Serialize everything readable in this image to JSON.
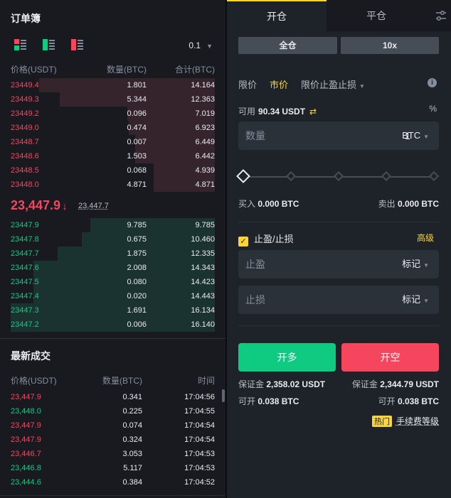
{
  "orderbook": {
    "title": "订单簿",
    "precision": "0.1",
    "headers": {
      "price": "价格(USDT)",
      "qty": "数量(BTC)",
      "total": "合计(BTC)"
    },
    "asks": [
      {
        "price": "23449.4",
        "qty": "1.801",
        "total": "14.164",
        "depth": 0.86
      },
      {
        "price": "23449.3",
        "qty": "5.344",
        "total": "12.363",
        "depth": 0.76
      },
      {
        "price": "23449.2",
        "qty": "0.096",
        "total": "7.019",
        "depth": 0.43
      },
      {
        "price": "23449.0",
        "qty": "0.474",
        "total": "6.923",
        "depth": 0.42
      },
      {
        "price": "23448.7",
        "qty": "0.007",
        "total": "6.449",
        "depth": 0.39
      },
      {
        "price": "23448.6",
        "qty": "1.503",
        "total": "6.442",
        "depth": 0.39
      },
      {
        "price": "23448.5",
        "qty": "0.068",
        "total": "4.939",
        "depth": 0.3
      },
      {
        "price": "23448.0",
        "qty": "4.871",
        "total": "4.871",
        "depth": 0.3
      }
    ],
    "last_price": "23,447.9",
    "mark_price": "23,447.7",
    "bids": [
      {
        "price": "23447.9",
        "qty": "9.785",
        "total": "9.785",
        "depth": 0.61
      },
      {
        "price": "23447.8",
        "qty": "0.675",
        "total": "10.460",
        "depth": 0.65
      },
      {
        "price": "23447.7",
        "qty": "1.875",
        "total": "12.335",
        "depth": 0.77
      },
      {
        "price": "23447.6",
        "qty": "2.008",
        "total": "14.343",
        "depth": 0.89
      },
      {
        "price": "23447.5",
        "qty": "0.080",
        "total": "14.423",
        "depth": 0.89
      },
      {
        "price": "23447.4",
        "qty": "0.020",
        "total": "14.443",
        "depth": 0.89
      },
      {
        "price": "23447.3",
        "qty": "1.691",
        "total": "16.134",
        "depth": 1.0
      },
      {
        "price": "23447.2",
        "qty": "0.006",
        "total": "16.140",
        "depth": 1.0
      }
    ]
  },
  "trades": {
    "title": "最新成交",
    "headers": {
      "price": "价格(USDT)",
      "qty": "数量(BTC)",
      "time": "时间"
    },
    "rows": [
      {
        "price": "23,447.9",
        "qty": "0.341",
        "time": "17:04:56",
        "side": "sell"
      },
      {
        "price": "23,448.0",
        "qty": "0.225",
        "time": "17:04:55",
        "side": "buy"
      },
      {
        "price": "23,447.9",
        "qty": "0.074",
        "time": "17:04:54",
        "side": "sell"
      },
      {
        "price": "23,447.9",
        "qty": "0.324",
        "time": "17:04:54",
        "side": "sell"
      },
      {
        "price": "23,446.7",
        "qty": "3.053",
        "time": "17:04:53",
        "side": "sell"
      },
      {
        "price": "23,446.8",
        "qty": "5.117",
        "time": "17:04:53",
        "side": "buy"
      },
      {
        "price": "23,444.6",
        "qty": "0.384",
        "time": "17:04:52",
        "side": "buy"
      }
    ]
  },
  "trade_panel": {
    "tab_open": "开仓",
    "tab_close": "平仓",
    "margin_mode": "全仓",
    "leverage": "10x",
    "order_types": [
      "限价",
      "市价",
      "限价止盈止损"
    ],
    "active_order_type": 1,
    "available_label": "可用",
    "available_value": "90.34 USDT",
    "qty_label": "数量",
    "qty_value": "1",
    "qty_unit": "BTC",
    "slider_percent": 0,
    "buy_label": "买入",
    "buy_value": "0.000 BTC",
    "sell_label": "卖出",
    "sell_value": "0.000 BTC",
    "tpsl_label": "止盈/止损",
    "tpsl_checked": true,
    "advanced": "高级",
    "tp_label": "止盈",
    "tp_select": "标记",
    "sl_label": "止损",
    "sl_select": "标记",
    "long_btn": "开多",
    "short_btn": "开空",
    "margin_label": "保证金",
    "long_margin": "2,358.02 USDT",
    "short_margin": "2,344.79 USDT",
    "openable_label": "可开",
    "long_openable": "0.038 BTC",
    "short_openable": "0.038 BTC",
    "hot_badge": "热门",
    "fee_link": "手续费等级"
  },
  "colors": {
    "ask": "#f6465d",
    "bid": "#0ecb81",
    "ask_depth": "#35242b",
    "bid_depth": "#1b3330",
    "accent": "#fcd535"
  },
  "icons": {
    "view_both": "orderbook-both-icon",
    "view_bids": "orderbook-bids-icon",
    "view_asks": "orderbook-asks-icon",
    "settings": "sliders-icon",
    "info": "info-icon",
    "swap": "swap-arrows-icon",
    "percent": "percent-icon",
    "down_arrow": "down-arrow-icon"
  }
}
